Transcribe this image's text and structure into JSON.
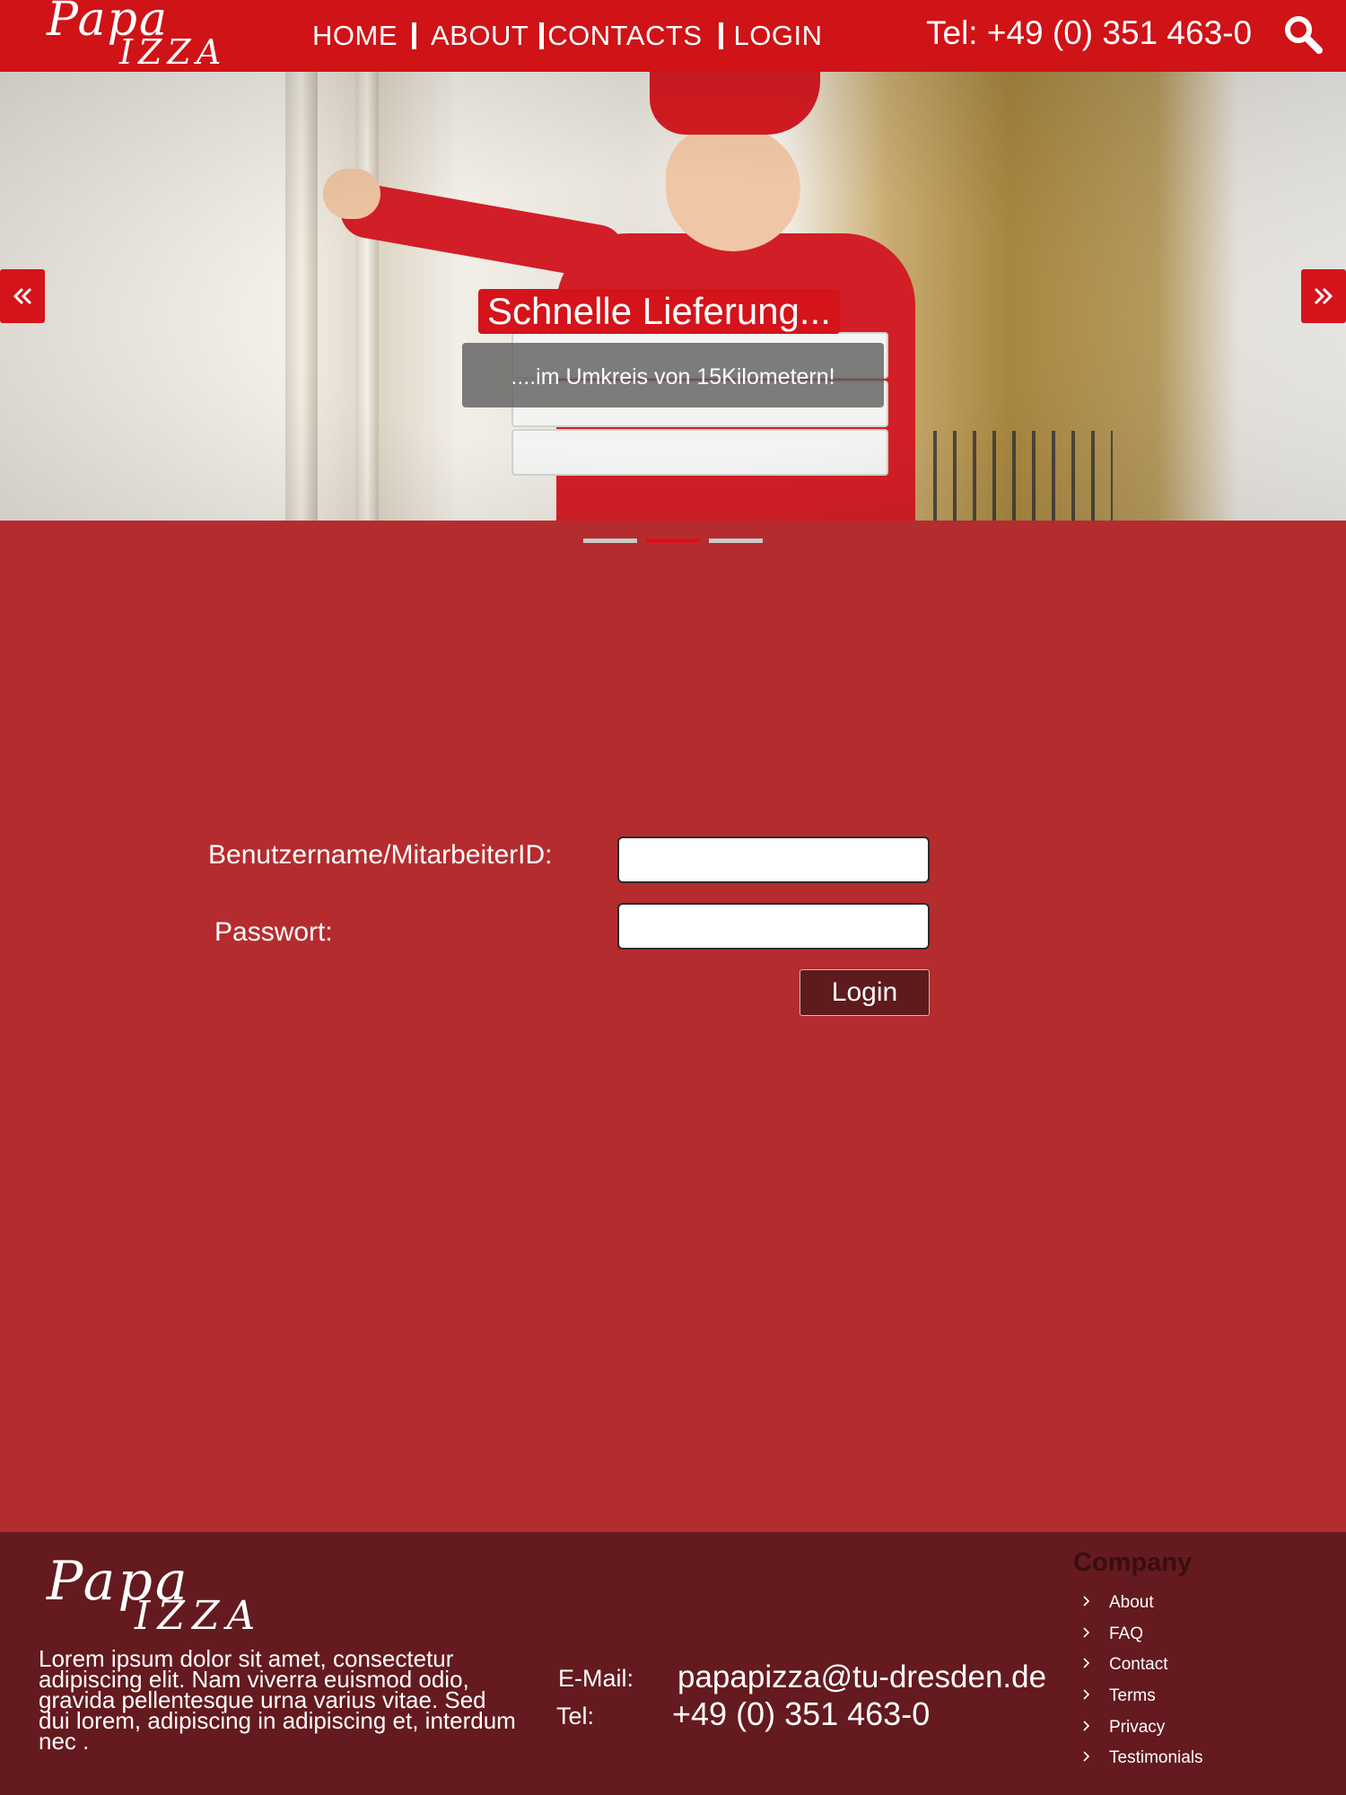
{
  "brand": {
    "logo_top": "Papa",
    "logo_bottom": "IZZA"
  },
  "nav": {
    "items": [
      {
        "label": "HOME"
      },
      {
        "label": "ABOUT"
      },
      {
        "label": "CONTACTS"
      },
      {
        "label": "LOGIN"
      }
    ]
  },
  "header": {
    "phone": "Tel:  +49 (0) 351 463-0",
    "search_icon": "search-icon"
  },
  "hero": {
    "title": "Schnelle Lieferung...",
    "subtitle": "....im Umkreis von  15Kilometern!",
    "prev_icon": "double-chevron-left-icon",
    "next_icon": "double-chevron-right-icon",
    "slide_count": 3,
    "active_slide": 2
  },
  "login": {
    "username_label": "Benutzername/MitarbeiterID:",
    "username_value": "",
    "password_label": "Passwort:",
    "password_value": "",
    "submit_label": "Login"
  },
  "footer": {
    "logo_top": "Papa",
    "logo_bottom": "IZZA",
    "description": "Lorem ipsum dolor sit amet, consectetur adipiscing elit. Nam viverra euismod odio, gravida pellentesque urna varius vitae. Sed dui lorem, adipiscing in adipiscing et, interdum nec .",
    "email_label": "E-Mail:",
    "email_value": "papapizza@tu-dresden.de",
    "tel_label": "Tel:",
    "tel_value": "+49 (0) 351 463-0",
    "company_title": "Company",
    "company_links": [
      {
        "label": "About"
      },
      {
        "label": "FAQ"
      },
      {
        "label": "Contact"
      },
      {
        "label": "Terms"
      },
      {
        "label": "Privacy"
      },
      {
        "label": "Testimonials"
      }
    ]
  },
  "colors": {
    "header_red": "#cf1317",
    "page_red": "#b52c2f",
    "footer_dark": "#641a1e",
    "accent_red": "#d5131a"
  }
}
